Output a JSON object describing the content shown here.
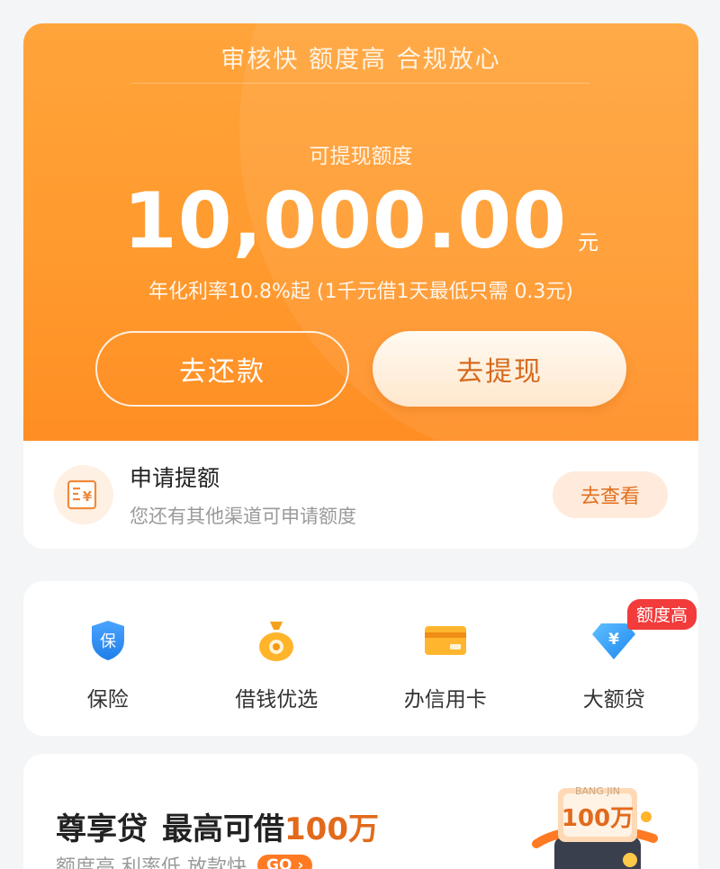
{
  "credit": {
    "slogan": "审核快 额度高 合规放心",
    "limit_label": "可提现额度",
    "limit_amount": "10,000.00",
    "limit_unit": "元",
    "rate_note": "年化利率10.8%起 (1千元借1天最低只需 0.3元)",
    "repay_label": "去还款",
    "withdraw_label": "去提现"
  },
  "apply": {
    "title": "申请提额",
    "subtitle": "您还有其他渠道可申请额度",
    "button": "去查看"
  },
  "services": [
    {
      "label": "保险",
      "icon": "shield-icon"
    },
    {
      "label": "借钱优选",
      "icon": "money-bag-icon"
    },
    {
      "label": "办信用卡",
      "icon": "credit-card-icon"
    },
    {
      "label": "大额贷",
      "icon": "diamond-yen-icon",
      "badge": "额度高"
    }
  ],
  "promo": {
    "name": "尊享贷",
    "headline_prefix": "最高可借",
    "highlight": "100万",
    "subtitle": "额度高 利率低 放款快",
    "go": "GO",
    "art_text": "100万",
    "art_brand": "BANG JIN"
  },
  "colors": {
    "accent": "#ff9a2e",
    "accent_text": "#e26a1c",
    "badge_red": "#f23b3b"
  }
}
